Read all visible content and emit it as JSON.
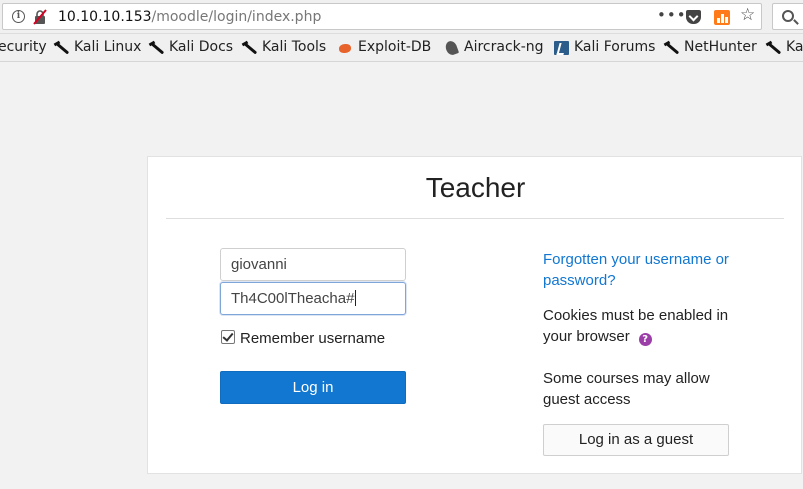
{
  "browser": {
    "url_host": "10.10.10.153",
    "url_path": "/moodle/login/index.php",
    "url_more": "•••",
    "star": "☆",
    "icons": [
      "info-icon",
      "insecure-lock-icon",
      "page-actions-icon",
      "pocket-icon",
      "reader-view-icon",
      "bookmark-star-icon",
      "search-icon"
    ]
  },
  "bookmarks": [
    {
      "label": "ecurity",
      "icon": "kali-icon"
    },
    {
      "label": "Kali Linux",
      "icon": "kali-icon"
    },
    {
      "label": "Kali Docs",
      "icon": "kali-icon"
    },
    {
      "label": "Kali Tools",
      "icon": "kali-icon"
    },
    {
      "label": "Exploit-DB",
      "icon": "exploit-db-icon"
    },
    {
      "label": "Aircrack-ng",
      "icon": "aircrack-icon"
    },
    {
      "label": "Kali Forums",
      "icon": "kali-forums-icon"
    },
    {
      "label": "NetHunter",
      "icon": "kali-icon"
    },
    {
      "label": "Ka",
      "icon": "kali-icon"
    }
  ],
  "login": {
    "title": "Teacher",
    "username_value": "giovanni",
    "password_value": "Th4C00lTheacha#",
    "remember_label": "Remember username",
    "remember_checked": true,
    "login_button": "Log in",
    "forgot_link": "Forgotten your username or password?",
    "cookies_text": "Cookies must be enabled in your browser",
    "help_symbol": "?",
    "guest_text": "Some courses may allow guest access",
    "guest_button": "Log in as a guest"
  },
  "colors": {
    "primary": "#1177d1",
    "help": "#9b3ea8",
    "reader": "#ff7a18"
  }
}
